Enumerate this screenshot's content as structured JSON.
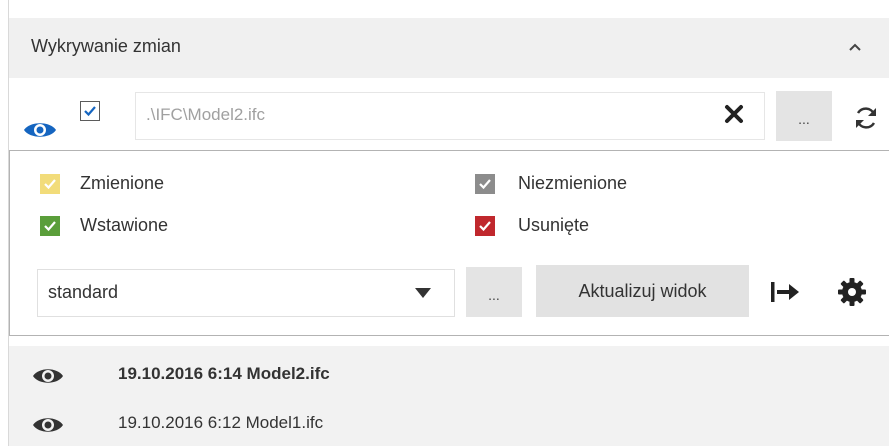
{
  "panel": {
    "title": "Wykrywanie zmian",
    "collapse_icon": "chevron-up-icon"
  },
  "file_row": {
    "visibility_icon": "eye-icon",
    "enabled": true,
    "path": ".\\IFC\\Model2.ifc",
    "clear_icon": "close-icon",
    "browse_label": "...",
    "refresh_icon": "refresh-icon"
  },
  "legend": {
    "items": [
      {
        "label": "Zmienione",
        "color": "#f2dc7a",
        "checked": true
      },
      {
        "label": "Niezmienione",
        "color": "#8c8c8c",
        "checked": true
      },
      {
        "label": "Wstawione",
        "color": "#5a9e3a",
        "checked": true
      },
      {
        "label": "Usunięte",
        "color": "#c0282d",
        "checked": true
      }
    ]
  },
  "view_controls": {
    "profile_value": "standard",
    "dots_label": "...",
    "update_label": "Aktualizuj widok",
    "export_icon": "export-icon",
    "settings_icon": "gear-icon"
  },
  "versions": [
    {
      "text": "19.10.2016 6:14 Model2.ifc",
      "bold": true
    },
    {
      "text": "19.10.2016 6:12 Model1.ifc",
      "bold": false
    }
  ]
}
